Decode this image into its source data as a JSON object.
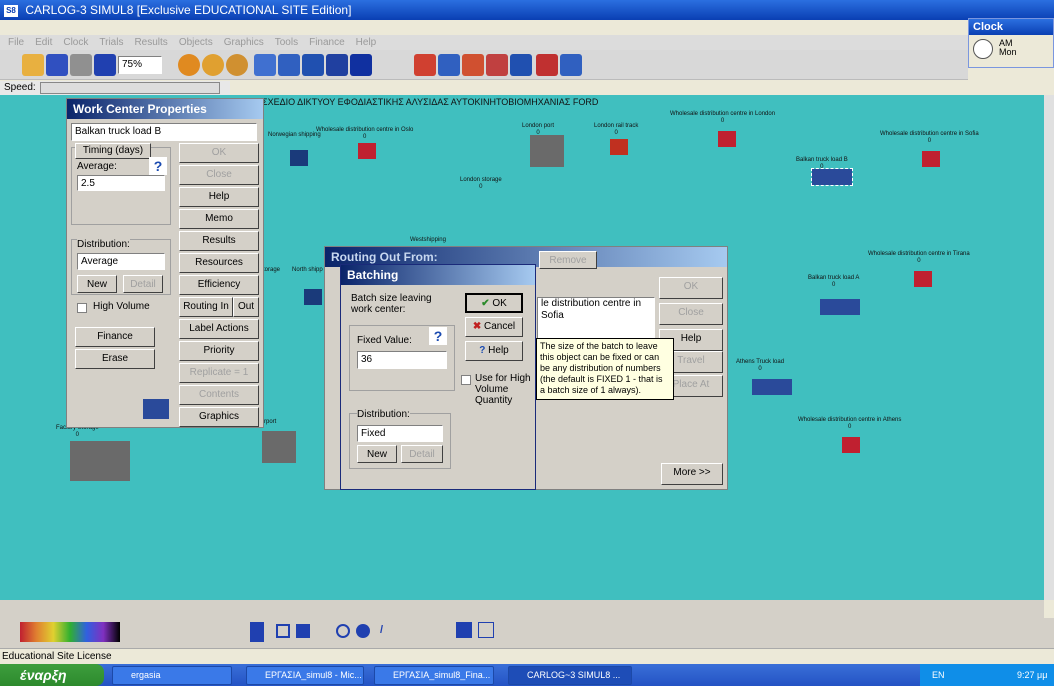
{
  "window": {
    "title": "CARLOG-3  SIMUL8 [Exclusive EDUCATIONAL SITE Edition]",
    "logo": "S8"
  },
  "clock": {
    "title": "Clock",
    "ampm": "AM",
    "day": "Mon"
  },
  "menu": [
    "File",
    "Edit",
    "Clock",
    "Trials",
    "Results",
    "Objects",
    "Graphics",
    "Tools",
    "Finance",
    "Help"
  ],
  "toolbar": {
    "zoom": "75%"
  },
  "speed": {
    "label": "Speed:"
  },
  "canvas": {
    "heading": "ΣΧΕΔΙΟ ΔΙΚΤΥΟΥ ΕΦΟΔΙΑΣΤΙΚΗΣ ΑΛΥΣΙΔΑΣ ΑΥΤΟΚΙΝΗΤΟΒΙΟΜΗΧΑΝΙΑΣ FORD",
    "nodes": [
      {
        "label": "Norwegian shipping",
        "count": ""
      },
      {
        "label": "Wholesale distribution centre in Oslo",
        "count": "0"
      },
      {
        "label": "London port",
        "count": "0"
      },
      {
        "label": "London rail track",
        "count": "0"
      },
      {
        "label": "Wholesale distribution centre in London",
        "count": "0"
      },
      {
        "label": "Wholesale distribution centre in Sofia",
        "count": "0"
      },
      {
        "label": "Balkan truck load B",
        "count": "0"
      },
      {
        "label": "London storage",
        "count": "0"
      },
      {
        "label": "Westshipping",
        "count": ""
      },
      {
        "label": "Wholesale distribution centre in Tirana",
        "count": "0"
      },
      {
        "label": "Balkan truck load A",
        "count": "0"
      },
      {
        "label": "North shipp",
        "count": ""
      },
      {
        "label": "Athens Truck load",
        "count": "0"
      },
      {
        "label": "Wholesale distribution centre in Athens",
        "count": "0"
      },
      {
        "label": "Factory Storage",
        "count": "0"
      },
      {
        "label": "storage",
        "count": ""
      },
      {
        "label": "rport",
        "count": ""
      }
    ]
  },
  "work_center": {
    "title": "Work Center Properties",
    "name": "Balkan truck load B",
    "timing_btn": "Timing (days)",
    "average_label": "Average:",
    "average_value": "2.5",
    "distribution_label": "Distribution:",
    "distribution_value": "Average",
    "new_btn": "New",
    "detail_btn": "Detail",
    "high_volume": "High Volume",
    "finance_btn": "Finance",
    "erase_btn": "Erase",
    "right_buttons": [
      "OK",
      "Close",
      "Help",
      "Memo",
      "Results",
      "Resources",
      "Efficiency",
      "Label Actions",
      "Priority",
      "Replicate = 1",
      "Contents",
      "Graphics"
    ],
    "routing_in": "Routing In",
    "routing_out": "Out"
  },
  "routing": {
    "title": "Routing Out From:",
    "remove_btn": "Remove",
    "ok_btn": "OK",
    "close_btn": "Close",
    "help_btn": "Help",
    "travel_btn": "Travel",
    "place_btn": "Place At",
    "more_btn": "More >>",
    "list_item": "le distribution centre in Sofia"
  },
  "batching": {
    "title": "Batching",
    "batch_label": "Batch size leaving work center:",
    "ok_btn": "OK",
    "cancel_btn": "Cancel",
    "help_btn": "Help",
    "fixed_label": "Fixed Value:",
    "fixed_value": "36",
    "use_high": "Use for High Volume Quantity",
    "distribution_label": "Distribution:",
    "distribution_value": "Fixed",
    "new_btn": "New",
    "detail_btn": "Detail"
  },
  "tooltip": {
    "text": "The size of the batch to leave this object can be fixed or can be any distribution of numbers (the default is FIXED 1 - that is a batch size of 1 always)."
  },
  "license": "Educational Site License",
  "taskbar": {
    "start": "έναρξη",
    "tasks": [
      "ergasia",
      "ΕΡΓΑΣΙΑ_simul8 - Mic...",
      "ΕΡΓΑΣΙΑ_simul8_Fina...",
      "CARLOG~3  SIMUL8 ..."
    ],
    "lang": "EN",
    "time": "9:27 μμ"
  }
}
